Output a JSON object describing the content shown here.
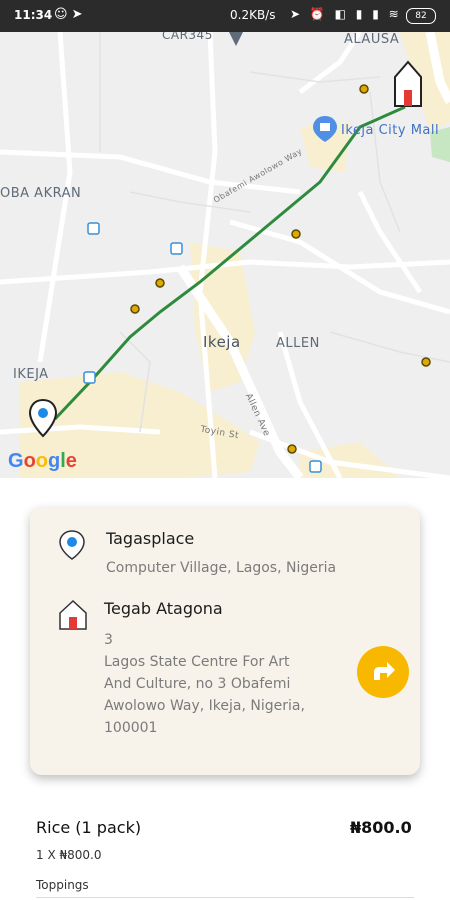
{
  "status_bar": {
    "time": "11:34",
    "network_speed": "0.2KB/s",
    "battery": "82",
    "left_icons": "☺ ➤",
    "right_icons": "➤ ⏰ ◧ ▮ ▮ ≋"
  },
  "map": {
    "labels": {
      "top_cut": "CAR345",
      "alausa": "ALAUSA",
      "oba_akran": "OBA AKRAN",
      "mall": "Ikeja City Mall",
      "road": "Obafemi Awolowo Way",
      "ikeja_center": "Ikeja",
      "allen": "ALLEN",
      "ikeja_left": "IKEJA",
      "allen_ave": "Allen Ave",
      "toyin": "Toyin St"
    },
    "google_logo": "Google",
    "route_color": "#2e8b3d"
  },
  "card": {
    "origin_name": "Tagasplace",
    "origin_address": "Computer Village, Lagos, Nigeria",
    "destination_name": "Tegab Atagona",
    "destination_address_lines": [
      "3",
      "Lagos State Centre For Art",
      "And Culture, no 3 Obafemi",
      "Awolowo Way, Ikeja, Nigeria,",
      "100001"
    ]
  },
  "order": {
    "item_name": "Rice",
    "item_unit": "(1 pack)",
    "item_price": "₦800.0",
    "item_qty": "1 X ₦800.0",
    "toppings_label": "Toppings"
  },
  "colors": {
    "accent": "#f9b800",
    "pin_blue": "#1e88e5",
    "card_bg": "#f7f3ea"
  }
}
